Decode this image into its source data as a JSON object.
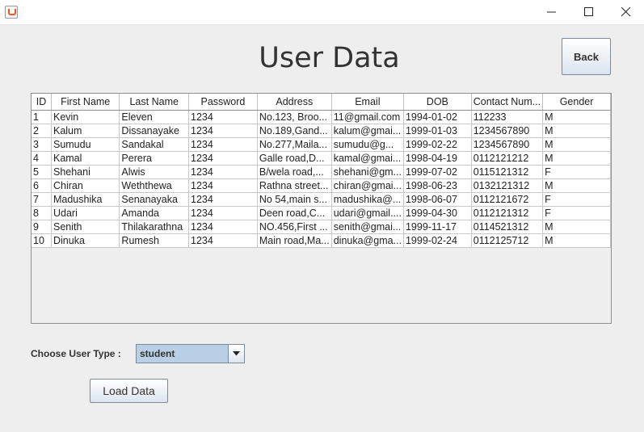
{
  "window": {
    "title_bar": {
      "app_icon": "java-cup-icon",
      "controls": [
        "minimize-icon",
        "maximize-icon",
        "close-icon"
      ]
    }
  },
  "header": {
    "title": "User Data",
    "back_label": "Back"
  },
  "table": {
    "columns": [
      "ID",
      "First Name",
      "Last Name",
      "Password",
      "Address",
      "Email",
      "DOB",
      "Contact Num...",
      "Gender"
    ],
    "rows": [
      [
        "1",
        "Kevin",
        "Eleven",
        "1234",
        "No.123, Broo...",
        "11@gmail.com",
        "1994-01-02",
        "112233",
        "M"
      ],
      [
        "2",
        "Kalum",
        "Dissanayake",
        "1234",
        "No.189,Gand...",
        "kalum@gmai...",
        "1999-01-03",
        "1234567890",
        "M"
      ],
      [
        "3",
        "Sumudu",
        "Sandakal",
        "1234",
        "No.277,Maila...",
        "sumudu@g...",
        "1999-02-22",
        "1234567890",
        "M"
      ],
      [
        "4",
        "Kamal",
        "Perera",
        "1234",
        "Galle road,D...",
        "kamal@gmai...",
        "1998-04-19",
        "0112121212",
        "M"
      ],
      [
        "5",
        "Shehani",
        "Alwis",
        "1234",
        "B/wela road,...",
        "shehani@gm...",
        "1999-07-02",
        "0115121312",
        "F"
      ],
      [
        "6",
        "Chiran",
        "Weththewa",
        "1234",
        "Rathna street...",
        "chiran@gmai...",
        "1998-06-23",
        "0132121312",
        "M"
      ],
      [
        "7",
        "Madushika",
        "Senanayaka",
        "1234",
        "No 54,main s...",
        "madushika@...",
        "1998-06-07",
        "0112121672",
        "F"
      ],
      [
        "8",
        "Udari",
        "Amanda",
        "1234",
        "Deen road,C...",
        "udari@gmail....",
        "1999-04-30",
        "0112121312",
        "F"
      ],
      [
        "9",
        "Senith",
        "Thilakarathna",
        "1234",
        "NO.456,First ...",
        "senith@gmai...",
        "1999-11-17",
        "0114521312",
        "M"
      ],
      [
        "10",
        "Dinuka",
        "Rumesh",
        "1234",
        "Main road,Ma...",
        "dinuka@gma...",
        "1999-02-24",
        "0112125712",
        "M"
      ]
    ]
  },
  "controls": {
    "user_type_label": "Choose User Type :",
    "user_type_selected": "student",
    "dropdown_icon": "chevron-down-icon",
    "load_label": "Load Data"
  },
  "colors": {
    "background": "#eeeeee",
    "combo_bg": "#b8cfe5",
    "button_border": "#7a8a99"
  }
}
